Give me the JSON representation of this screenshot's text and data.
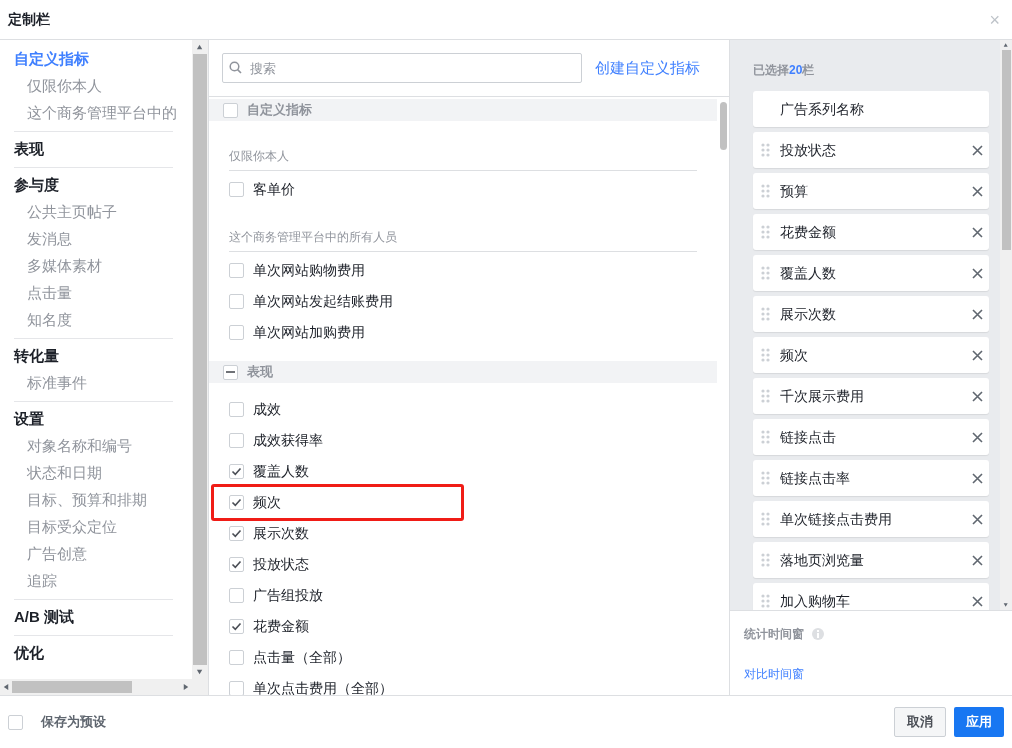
{
  "window": {
    "title": "定制栏",
    "close": "×"
  },
  "nav": [
    {
      "kind": "heading",
      "label": "自定义指标",
      "selected": true
    },
    {
      "kind": "sub",
      "label": "仅限你本人",
      "selected": false
    },
    {
      "kind": "sub",
      "label": "这个商务管理平台中的",
      "selected": false
    },
    {
      "kind": "heading",
      "label": "表现",
      "selected": false
    },
    {
      "kind": "heading",
      "label": "参与度",
      "selected": false
    },
    {
      "kind": "sub",
      "label": "公共主页帖子",
      "selected": false
    },
    {
      "kind": "sub",
      "label": "发消息",
      "selected": false
    },
    {
      "kind": "sub",
      "label": "多媒体素材",
      "selected": false
    },
    {
      "kind": "sub",
      "label": "点击量",
      "selected": false
    },
    {
      "kind": "sub",
      "label": "知名度",
      "selected": false
    },
    {
      "kind": "heading",
      "label": "转化量",
      "selected": false
    },
    {
      "kind": "sub",
      "label": "标准事件",
      "selected": false
    },
    {
      "kind": "heading",
      "label": "设置",
      "selected": false
    },
    {
      "kind": "sub",
      "label": "对象名称和编号",
      "selected": false
    },
    {
      "kind": "sub",
      "label": "状态和日期",
      "selected": false
    },
    {
      "kind": "sub",
      "label": "目标、预算和排期",
      "selected": false
    },
    {
      "kind": "sub",
      "label": "目标受众定位",
      "selected": false
    },
    {
      "kind": "sub",
      "label": "广告创意",
      "selected": false
    },
    {
      "kind": "sub",
      "label": "追踪",
      "selected": false
    },
    {
      "kind": "heading",
      "label": "A/B 测试",
      "selected": false
    },
    {
      "kind": "heading",
      "label": "优化",
      "selected": false
    }
  ],
  "search": {
    "placeholder": "搜索"
  },
  "create_link": "创建自定义指标",
  "metrics": [
    {
      "kind": "group",
      "label": "自定义指标",
      "indeterminate": false
    },
    {
      "kind": "subheader",
      "label": "仅限你本人"
    },
    {
      "kind": "item",
      "label": "客单价",
      "checked": false,
      "highlighted": false
    },
    {
      "kind": "subheader",
      "label": "这个商务管理平台中的所有人员"
    },
    {
      "kind": "item",
      "label": "单次网站购物费用",
      "checked": false,
      "highlighted": false
    },
    {
      "kind": "item",
      "label": "单次网站发起结账费用",
      "checked": false,
      "highlighted": false
    },
    {
      "kind": "item",
      "label": "单次网站加购费用",
      "checked": false,
      "highlighted": false
    },
    {
      "kind": "group",
      "label": "表现",
      "indeterminate": true
    },
    {
      "kind": "item",
      "label": "成效",
      "checked": false,
      "highlighted": false
    },
    {
      "kind": "item",
      "label": "成效获得率",
      "checked": false,
      "highlighted": false
    },
    {
      "kind": "item",
      "label": "覆盖人数",
      "checked": true,
      "highlighted": false
    },
    {
      "kind": "item",
      "label": "频次",
      "checked": true,
      "highlighted": true
    },
    {
      "kind": "item",
      "label": "展示次数",
      "checked": true,
      "highlighted": false
    },
    {
      "kind": "item",
      "label": "投放状态",
      "checked": true,
      "highlighted": false
    },
    {
      "kind": "item",
      "label": "广告组投放",
      "checked": false,
      "highlighted": false
    },
    {
      "kind": "item",
      "label": "花费金额",
      "checked": true,
      "highlighted": false
    },
    {
      "kind": "item",
      "label": "点击量（全部）",
      "checked": false,
      "highlighted": false
    },
    {
      "kind": "item",
      "label": "单次点击费用（全部）",
      "checked": false,
      "highlighted": false
    }
  ],
  "selected_summary": "已选择**20**栏",
  "selected_columns": [
    {
      "kind": "fixed",
      "label": "广告系列名称"
    },
    {
      "kind": "movable",
      "label": "投放状态"
    },
    {
      "kind": "movable",
      "label": "预算"
    },
    {
      "kind": "movable",
      "label": "花费金额"
    },
    {
      "kind": "movable",
      "label": "覆盖人数"
    },
    {
      "kind": "movable",
      "label": "展示次数"
    },
    {
      "kind": "movable",
      "label": "频次"
    },
    {
      "kind": "movable",
      "label": "千次展示费用"
    },
    {
      "kind": "movable",
      "label": "链接点击"
    },
    {
      "kind": "movable",
      "label": "链接点击率"
    },
    {
      "kind": "movable",
      "label": "单次链接点击费用"
    },
    {
      "kind": "movable",
      "label": "落地页浏览量"
    },
    {
      "kind": "movable",
      "label": "加入购物车"
    }
  ],
  "attribution_label": "统计时间窗",
  "compare_link": "对比时间窗",
  "footer": {
    "save_preset": {
      "label": "保存为预设",
      "checked": false
    },
    "cancel": "取消",
    "apply": "应用"
  }
}
